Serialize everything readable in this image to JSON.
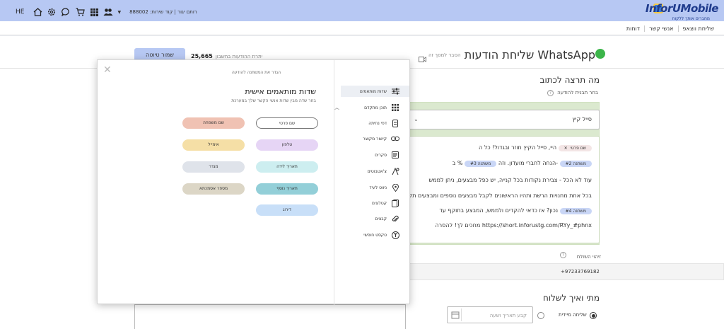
{
  "header": {
    "lang": "HE",
    "account": "רותם יגור | קוד שירות: 888002",
    "logo_main": "InforUMobile",
    "logo_sub": "מחברים אותך ללקוח"
  },
  "nav": {
    "links": [
      "שליחת ווצאפ",
      "אנשי קשר",
      "דוחות"
    ]
  },
  "page": {
    "title": "שליחת הודעות WhatsApp",
    "explain": "הסבר למסך זה",
    "msg_count_label": "יתרת ההודעות בחשבון",
    "msg_count_value": "25,665",
    "save_draft": "שמור טיוטה"
  },
  "compose": {
    "what_title": "מה תרצה לכתוב",
    "template_label": "בחר תבנית להודעה",
    "template_value": "סייל קיץ",
    "line1_text": "היי, סייל הקיץ חוזר ובגדול! כל ה",
    "chip_first": "שם פרטי",
    "line2_text1": "ב-",
    "line2_text2": "%",
    "line2_text3": "הנחה לחברי מועדון. וזה",
    "chip_var2": "משתנה #2",
    "chip_var3": "משתנה #3",
    "line3_text": "עוד לא הכל - צבירת נקודות בכל קנייה, יש כפל מבצעים, ניתן לממש",
    "line4_text": "בכל אחת מחנויות הרשת ותהיו הראשונים לקבל מבצעים נוספים ומבצעים תקפים גם באחרים. נשמע טוב",
    "line5_text": "נכון? אז כדאי להקדים ולממש, המבצע בתוקף עד",
    "chip_var4": "משתנה #4",
    "line6_text": "מחכים לך! להסרה https://short.inforustg.com/RYy_#phnx"
  },
  "sender": {
    "label": "זיהוי השולח",
    "value": "+97233769182"
  },
  "when": {
    "title": "מתי ואיך לשלוח",
    "immediate": "שליחה מיידית",
    "date_placeholder": "קבע תאריך ושעה"
  },
  "modal": {
    "hint": "הגדר את המשתנה להודעה",
    "title": "שדות מותאמים אישית",
    "subtitle": "בחר שדה מבין שדות אנשי הקשר שלך במערכת",
    "pills": [
      {
        "label": "שם פרטי",
        "color": "#ffffff"
      },
      {
        "label": "שם משפחה",
        "color": "#f0c2b3"
      },
      {
        "label": "טלפון",
        "color": "#e6d5f5"
      },
      {
        "label": "אימייל",
        "color": "#f5dfa6"
      },
      {
        "label": "תאריך לידה",
        "color": "#cdeef0"
      },
      {
        "label": "מגדר",
        "color": "#dfe3ea"
      },
      {
        "label": "תאריך נוסף",
        "color": "#93cfd8"
      },
      {
        "label": "מספר אסמכתא",
        "color": "#dcd6c6"
      },
      {
        "label": "דירוג",
        "color": "#c8dff8"
      }
    ],
    "sidebar": {
      "custom_fields": "שדות מותאמים",
      "advanced": "תוכן מתקדם",
      "items": [
        "דפי נחיתה",
        "קישור מקוצר",
        "סקרים",
        "צ'אטבוטים",
        "ניווט לעיד",
        "קטלוגים",
        "קבצים",
        "טקסט חופשי"
      ]
    }
  }
}
